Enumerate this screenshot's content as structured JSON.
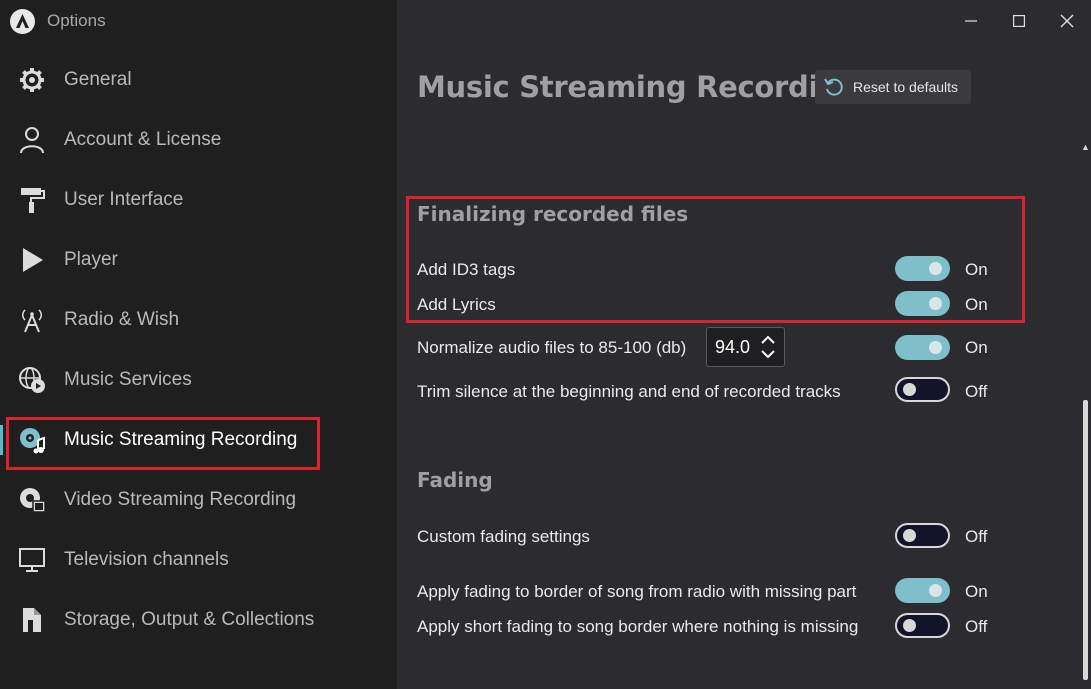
{
  "window": {
    "title": "Options",
    "controls": {
      "minimize": "—",
      "maximize": "☐",
      "close": "✕"
    }
  },
  "sidebar": {
    "items": [
      {
        "label": "General",
        "icon": "gear-icon"
      },
      {
        "label": "Account & License",
        "icon": "user-icon"
      },
      {
        "label": "User Interface",
        "icon": "paint-roller-icon"
      },
      {
        "label": "Player",
        "icon": "play-icon"
      },
      {
        "label": "Radio & Wish",
        "icon": "antenna-icon"
      },
      {
        "label": "Music Services",
        "icon": "globe-play-icon"
      },
      {
        "label": "Music Streaming Recording",
        "icon": "music-record-icon",
        "active": true
      },
      {
        "label": "Video Streaming Recording",
        "icon": "video-record-icon"
      },
      {
        "label": "Television channels",
        "icon": "monitor-icon"
      },
      {
        "label": "Storage, Output & Collections",
        "icon": "storage-icon"
      }
    ]
  },
  "main": {
    "title": "Music Streaming Recording",
    "reset_label": "Reset to defaults",
    "sections": {
      "finalizing": {
        "title": "Finalizing recorded files",
        "rows": [
          {
            "label": "Add ID3 tags",
            "state": "On"
          },
          {
            "label": "Add Lyrics",
            "state": "On"
          },
          {
            "label": "Normalize audio files to 85-100 (db)",
            "state": "On",
            "value": "94.0"
          },
          {
            "label": "Trim silence at the beginning and end of recorded tracks",
            "state": "Off"
          }
        ]
      },
      "fading": {
        "title": "Fading",
        "rows": [
          {
            "label": "Custom fading settings",
            "state": "Off"
          },
          {
            "label": "Apply fading to border of song from radio with missing part",
            "state": "On"
          },
          {
            "label": "Apply short fading to song border where nothing is missing",
            "state": "Off"
          }
        ]
      }
    }
  },
  "colors": {
    "sidebar_bg": "#1f1f1f",
    "main_bg": "#2b2b30",
    "accent": "#7fbfc9",
    "highlight": "#d9242f"
  }
}
